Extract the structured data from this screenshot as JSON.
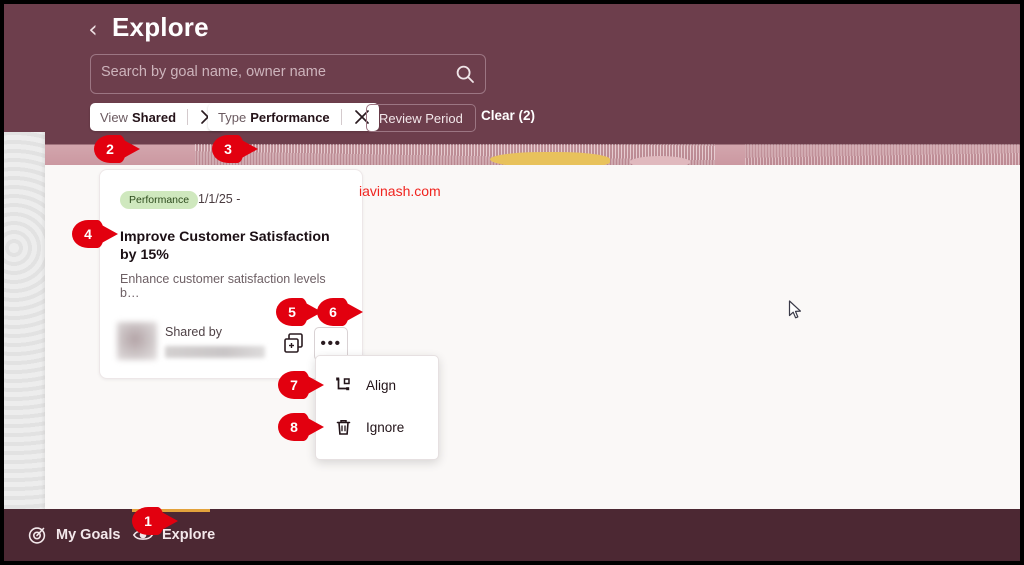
{
  "header": {
    "back_icon": "chevron-left-icon",
    "title": "Explore",
    "search": {
      "placeholder": "Search by goal name, owner name",
      "value": "",
      "icon": "search-icon"
    },
    "filters": [
      {
        "label": "View",
        "value": "Shared",
        "close_icon": "close-icon"
      },
      {
        "label": "Type",
        "value": "Performance",
        "close_icon": "close-icon"
      }
    ],
    "review_period_label": "Review Period",
    "clear_label": "Clear (2)"
  },
  "card": {
    "badge": "Performance",
    "date": "1/1/25 -",
    "title": "Improve Customer Satisfaction by 15%",
    "description": "Enhance customer satisfaction levels b…",
    "shared_by_label": "Shared by",
    "shared_by_name": "",
    "avatar": "user-avatar",
    "duplicate_icon": "duplicate-icon",
    "more_icon": "more-horizontal-icon",
    "more_label": "•••"
  },
  "more_menu": {
    "items": [
      {
        "label": "Align",
        "icon": "align-icon"
      },
      {
        "label": "Ignore",
        "icon": "trash-icon"
      }
    ]
  },
  "watermark": "iavinash.com",
  "bottom_nav": {
    "items": [
      {
        "label": "My Goals",
        "icon": "target-icon",
        "active": false
      },
      {
        "label": "Explore",
        "icon": "eye-icon",
        "active": true
      }
    ]
  },
  "markers": [
    {
      "id": "1",
      "number": "1"
    },
    {
      "id": "2",
      "number": "2"
    },
    {
      "id": "3",
      "number": "3"
    },
    {
      "id": "4",
      "number": "4"
    },
    {
      "id": "5",
      "number": "5"
    },
    {
      "id": "6",
      "number": "6"
    },
    {
      "id": "7",
      "number": "7"
    },
    {
      "id": "8",
      "number": "8"
    }
  ],
  "colors": {
    "header_maroon": "#6D3E4C",
    "bottom_bar": "#4C2833",
    "content_bg": "#FAF8F7",
    "accent_gold": "#E2A23C",
    "marker_red": "#E2000F",
    "badge_green_bg": "#CFE8BE",
    "watermark_red": "#F0241F"
  },
  "cursor": {
    "icon": "mouse-pointer-icon"
  }
}
